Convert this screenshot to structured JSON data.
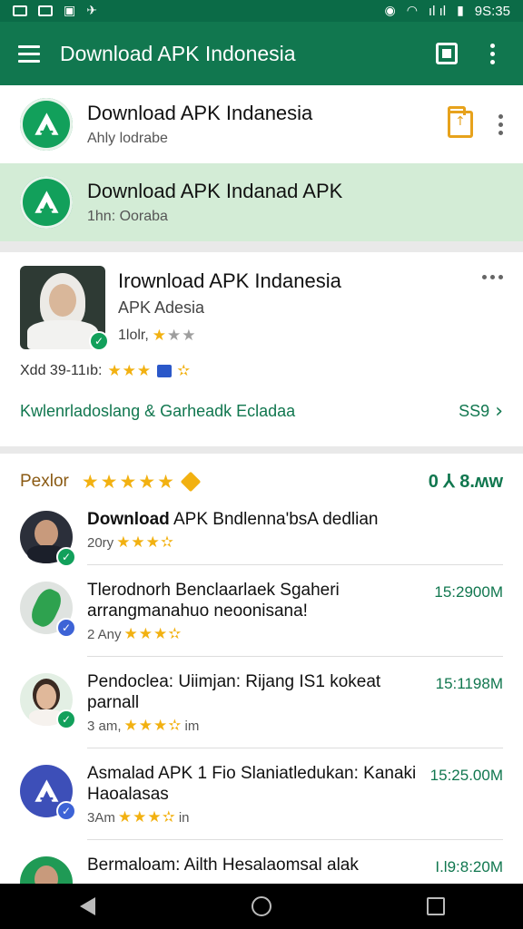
{
  "status_bar": {
    "time": "9S:35",
    "signal": "ıl ıl"
  },
  "app_bar": {
    "title": "Download APK Indonesia"
  },
  "top_items": [
    {
      "title": "Download APK Indanesia",
      "subtitle": "Ahly lodrabe"
    },
    {
      "title": "Download APK Indanad APK",
      "subtitle": "1hn: Ooraba"
    }
  ],
  "card": {
    "title": "Irownload APK Indanesia",
    "subtitle": "APK Adesia",
    "rating_prefix": "1lolr,",
    "meta_text": "Xdd 39-11ıb:",
    "link": "Kwlenrladoslang & Garheadk Ecladaa",
    "count": "SS9"
  },
  "section": {
    "label": "Pexlor",
    "count": "0 ⅄ 8.ʍw",
    "items": [
      {
        "title_bold": "Download",
        "title": " APK Bndlenna'bsA dedlian",
        "meta": "20ry",
        "time": ""
      },
      {
        "title": "Tlerodnorh Benclaarlaek Sgaheri arrangmanahuo neoonisana!",
        "meta": "2 Any",
        "time": "15:2900M"
      },
      {
        "title": "Pendoclea: Uiimjan: Rijang IS1 kokeat parnall",
        "meta": "3 am,",
        "suffix": "im",
        "time": "15:1198M"
      },
      {
        "title": "Asmalad APK 1 Fio Slaniatledukan: Kanaki Haoalasas",
        "meta": "3Am",
        "suffix": "in",
        "time": "15:25.00M"
      },
      {
        "title": "Bermaloam: Ailth Hesalaomsal alak",
        "meta": "",
        "time": "I.l9:8:20M"
      }
    ]
  }
}
